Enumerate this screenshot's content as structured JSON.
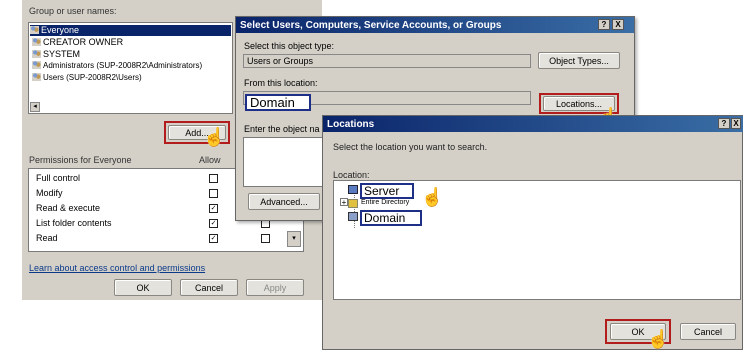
{
  "perm_dialog": {
    "group_label": "Group or user names:",
    "users": [
      "Everyone",
      "CREATOR OWNER",
      "SYSTEM",
      "Administrators (SUP-2008R2\\Administrators)",
      "Users (SUP-2008R2\\Users)"
    ],
    "add_button": "Add...",
    "permissions_label": "Permissions for Everyone",
    "allow_header": "Allow",
    "permissions": [
      {
        "name": "Full control",
        "allow": false,
        "deny": false
      },
      {
        "name": "Modify",
        "allow": false,
        "deny": false
      },
      {
        "name": "Read & execute",
        "allow": true,
        "deny": false
      },
      {
        "name": "List folder contents",
        "allow": true,
        "deny": false
      },
      {
        "name": "Read",
        "allow": true,
        "deny": false
      }
    ],
    "link": "Learn about access control and permissions",
    "ok": "OK",
    "cancel": "Cancel",
    "apply": "Apply"
  },
  "select_dialog": {
    "title": "Select Users, Computers, Service Accounts, or Groups",
    "object_type_label": "Select this object type:",
    "object_type_value": "Users or Groups",
    "object_types_button": "Object Types...",
    "location_label": "From this location:",
    "location_value": "Domain",
    "locations_button": "Locations...",
    "enter_names_label": "Enter the object na",
    "advanced_button": "Advanced...",
    "help_glyph": "?",
    "close_glyph": "X"
  },
  "locations_dialog": {
    "title": "Locations",
    "instruction": "Select the location you want to search.",
    "location_label": "Location:",
    "tree": [
      {
        "label": "Server",
        "highlight": true
      },
      {
        "label": "Entire Directory",
        "highlight": false
      },
      {
        "label": "Domain",
        "highlight": true
      }
    ],
    "ok": "OK",
    "cancel": "Cancel",
    "help_glyph": "?",
    "close_glyph": "X"
  },
  "colors": {
    "dialog_bg": "#d4d0c8",
    "titlebar": "#0a246a",
    "selection": "#0a246a",
    "highlight_border": "#b21c1c"
  },
  "glyphs": {
    "check": "✓",
    "expand": "+",
    "hand_cursor": "☝"
  }
}
